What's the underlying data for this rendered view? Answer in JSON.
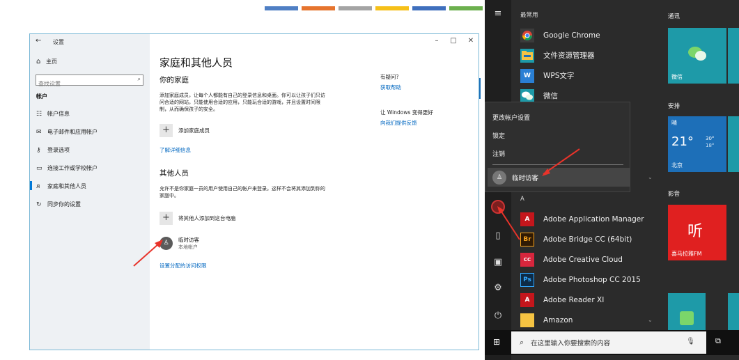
{
  "colors": {
    "stripes": [
      "#4f7fc4",
      "#e6742e",
      "#a4a4a4",
      "#f6c018",
      "#3f6fbd",
      "#6cb04e"
    ],
    "accent": "#0078d7",
    "link": "#0067c0",
    "annotation_arrow": "#e8332a",
    "start_bg": "#2b2b2b",
    "tile_teal": "#1e9aa8",
    "tile_red": "#e02020"
  },
  "settings": {
    "window_title": "设置",
    "window_controls": {
      "minimize": "–",
      "maximize": "□",
      "close": "✕"
    },
    "back_icon": "arrow-left-icon",
    "home_label": "主页",
    "search_placeholder": "查找设置",
    "section_heading": "帐户",
    "nav_items": [
      {
        "label": "帐户信息",
        "icon": "person-card-icon"
      },
      {
        "label": "电子邮件和应用帐户",
        "icon": "mail-icon"
      },
      {
        "label": "登录选项",
        "icon": "key-icon"
      },
      {
        "label": "连接工作或学校帐户",
        "icon": "briefcase-icon"
      },
      {
        "label": "家庭和其他人员",
        "icon": "people-icon",
        "active": true
      },
      {
        "label": "同步你的设置",
        "icon": "sync-icon"
      }
    ],
    "page_title": "家庭和其他人员",
    "family": {
      "title": "你的家庭",
      "description": "添加家庭成员，让每个人都能有自己的登录信息和桌面。你可以让孩子们只访问合适的网站，只能使用合适的应用，只能玩合适的游戏，并且设置时间限制，从而确保孩子的安全。",
      "add_label": "添加家庭成员",
      "learn_more": "了解详细信息"
    },
    "others": {
      "title": "其他人员",
      "description": "允许不是你家庭一员的用户使用自己的帐户来登录。这样不会将其添加到你的家庭中。",
      "add_label": "将其他人添加到这台电脑",
      "user_name": "临时访客",
      "user_type": "本地帐户",
      "assigned_access": "设置分配的访问权限"
    },
    "help": {
      "question": "有疑问?",
      "get_help": "获取帮助",
      "improve": "让 Windows 变得更好",
      "feedback": "向我们提供反馈"
    }
  },
  "start_menu": {
    "most_used_heading": "最常用",
    "most_used": [
      {
        "label": "Google Chrome",
        "icon": "chrome-icon"
      },
      {
        "label": "文件资源管理器",
        "icon": "folder-icon"
      },
      {
        "label": "WPS文字",
        "icon": "wps-icon"
      },
      {
        "label": "微信",
        "icon": "wechat-icon"
      }
    ],
    "account_menu": {
      "change_settings": "更改帐户设置",
      "lock": "锁定",
      "sign_out": "注销",
      "guest_user": "临时访客"
    },
    "letter_heading": "A",
    "apps": [
      {
        "label": "Adobe Application Manager",
        "icon": "adobe-icon",
        "badge": "A"
      },
      {
        "label": "Adobe Bridge CC (64bit)",
        "icon": "bridge-icon",
        "badge": "Br"
      },
      {
        "label": "Adobe Creative Cloud",
        "icon": "creative-cloud-icon",
        "badge": "CC"
      },
      {
        "label": "Adobe Photoshop CC 2015",
        "icon": "photoshop-icon",
        "badge": "Ps"
      },
      {
        "label": "Adobe Reader XI",
        "icon": "acrobat-icon",
        "badge": "A"
      },
      {
        "label": "Amazon",
        "icon": "amazon-folder-icon",
        "badge": ""
      }
    ],
    "tiles": {
      "communication_heading": "通讯",
      "wechat_tile": "微信",
      "arrange_heading": "安排",
      "weather": {
        "condition": "晴",
        "temp": "21°",
        "high": "30°",
        "low": "18°",
        "city": "北京"
      },
      "media_heading": "影音",
      "radio_tile": "喜马拉雅FM",
      "radio_glyph": "听"
    },
    "taskbar": {
      "search_placeholder": "在这里输入你要搜索的内容"
    }
  }
}
